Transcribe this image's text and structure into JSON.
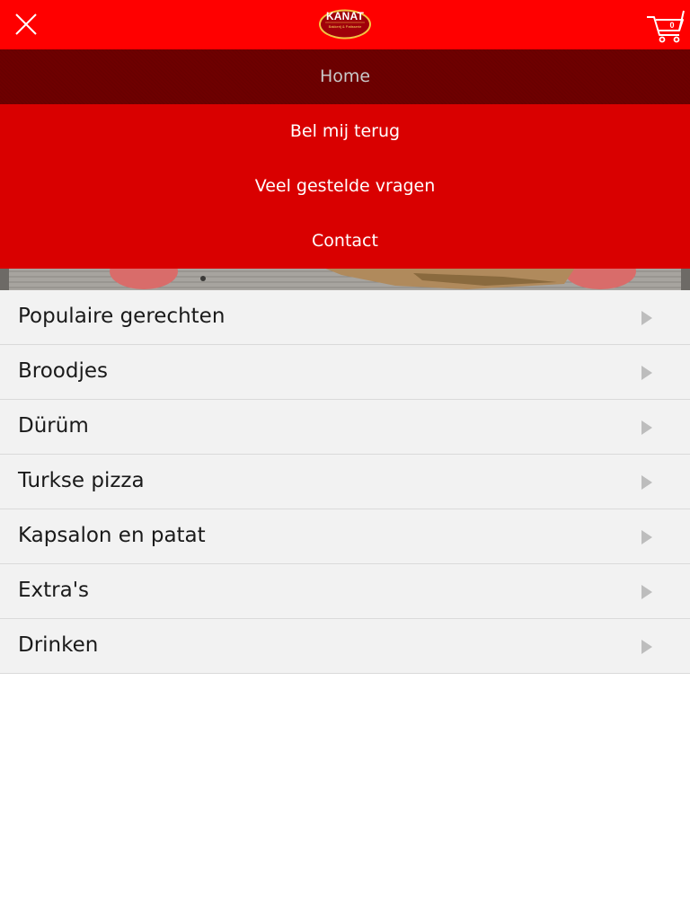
{
  "header": {
    "logo_text": "KANAT",
    "logo_subtext": "Bakkerij & Patisserie",
    "cart_count": "0",
    "colors": {
      "topbar": "#ff0000",
      "logo_bg": "#a0000a",
      "logo_border": "#f4c542"
    },
    "icons": {
      "close": "close-icon",
      "cart": "shopping-cart-icon"
    }
  },
  "nav_menu": {
    "items": [
      {
        "label": "Home",
        "active": true
      },
      {
        "label": "Bel mij terug",
        "active": false
      },
      {
        "label": "Veel gestelde vragen",
        "active": false
      },
      {
        "label": "Contact",
        "active": false
      }
    ],
    "colors": {
      "item_bg": "#d90000",
      "active_bg": "#6e0000",
      "item_text": "#ffffff",
      "active_text": "#c9c9c9"
    }
  },
  "categories": {
    "items": [
      {
        "label": "Populaire gerechten"
      },
      {
        "label": "Broodjes"
      },
      {
        "label": "Dürüm"
      },
      {
        "label": "Turkse pizza"
      },
      {
        "label": "Kapsalon en patat"
      },
      {
        "label": "Extra's"
      },
      {
        "label": "Drinken"
      }
    ],
    "colors": {
      "row_bg": "#f2f2f2",
      "divider": "#dadada",
      "chevron": "#bdbdbd"
    },
    "icon": "chevron-right-icon"
  }
}
